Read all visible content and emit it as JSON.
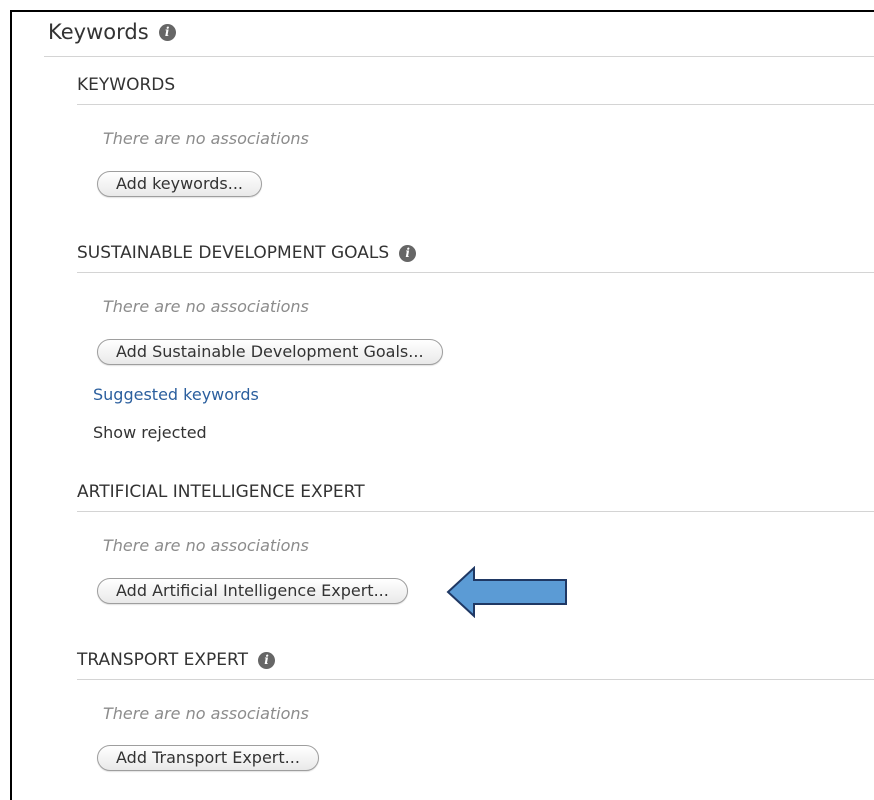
{
  "panel": {
    "title": "Keywords"
  },
  "sections": {
    "keywords": {
      "title": "KEYWORDS",
      "empty_text": "There are no associations",
      "button_label": "Add keywords..."
    },
    "sdg": {
      "title": "SUSTAINABLE DEVELOPMENT GOALS",
      "empty_text": "There are no associations",
      "button_label": "Add Sustainable Development Goals...",
      "suggested_link": "Suggested keywords",
      "show_rejected": "Show rejected"
    },
    "ai_expert": {
      "title": "ARTIFICIAL INTELLIGENCE EXPERT",
      "empty_text": "There are no associations",
      "button_label": "Add Artificial Intelligence Expert..."
    },
    "transport_expert": {
      "title": "TRANSPORT EXPERT",
      "empty_text": "There are no associations",
      "button_label": "Add Transport Expert..."
    }
  },
  "icons": {
    "info": "info-icon",
    "arrow": "left-arrow-icon"
  },
  "colors": {
    "arrow_fill": "#5b9bd5",
    "arrow_stroke": "#1f3864",
    "link": "#2b5f9e",
    "info_icon": "#666666"
  }
}
